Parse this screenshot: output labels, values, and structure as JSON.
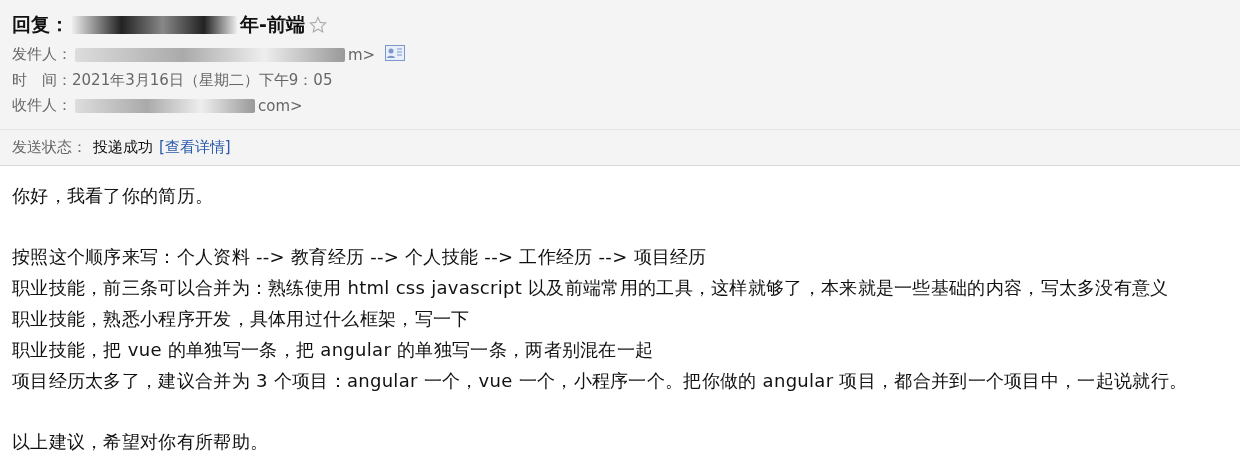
{
  "header": {
    "subject": {
      "prefix": "回复：",
      "suffix": "年-前端",
      "starred": false
    },
    "sender": {
      "label": "发件人：",
      "value_end": "m>"
    },
    "time": {
      "label": "时　间：",
      "value": "2021年3月16日（星期二）下午9：05"
    },
    "recipient": {
      "label": "收件人：",
      "value_end": "com>"
    },
    "status": {
      "label": "发送状态：",
      "value": "投递成功",
      "link": "[查看详情]"
    }
  },
  "body": {
    "paragraphs": [
      [
        "你好，我看了你的简历。"
      ],
      [
        "按照这个顺序来写：个人资料 --> 教育经历 --> 个人技能 --> 工作经历 --> 项目经历",
        "职业技能，前三条可以合并为：熟练使用 html css javascript 以及前端常用的工具，这样就够了，本来就是一些基础的内容，写太多没有意义",
        "职业技能，熟悉小程序开发，具体用过什么框架，写一下",
        "职业技能，把 vue 的单独写一条，把 angular 的单独写一条，两者别混在一起",
        "项目经历太多了，建议合并为 3 个项目：angular 一个，vue 一个，小程序一个。把你做的 angular 项目，都合并到一个项目中，一起说就行。"
      ],
      [
        "以上建议，希望对你有所帮助。"
      ]
    ]
  }
}
